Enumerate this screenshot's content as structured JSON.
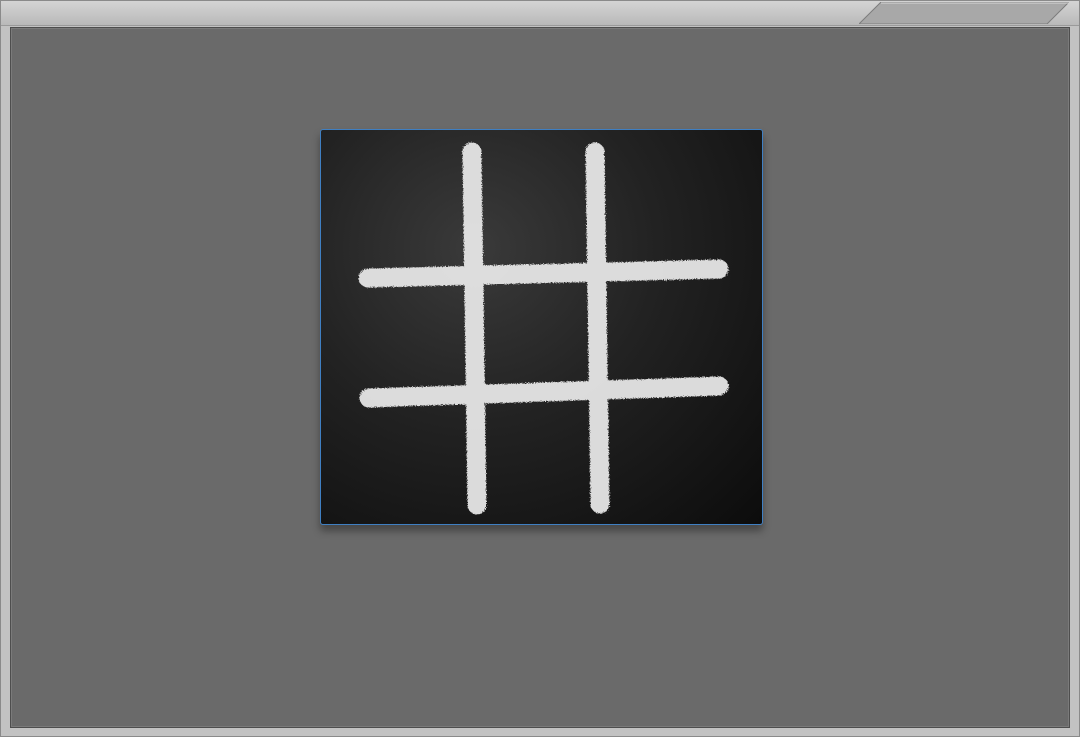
{
  "window": {
    "title": ""
  },
  "game": {
    "name": "tic-tac-toe",
    "board": [
      [
        "",
        "",
        ""
      ],
      [
        "",
        "",
        ""
      ],
      [
        "",
        "",
        ""
      ]
    ],
    "colors": {
      "chalk": "#e8e8e8",
      "board_frame": "#3f7fc2",
      "background": "#6a6a6a"
    }
  }
}
